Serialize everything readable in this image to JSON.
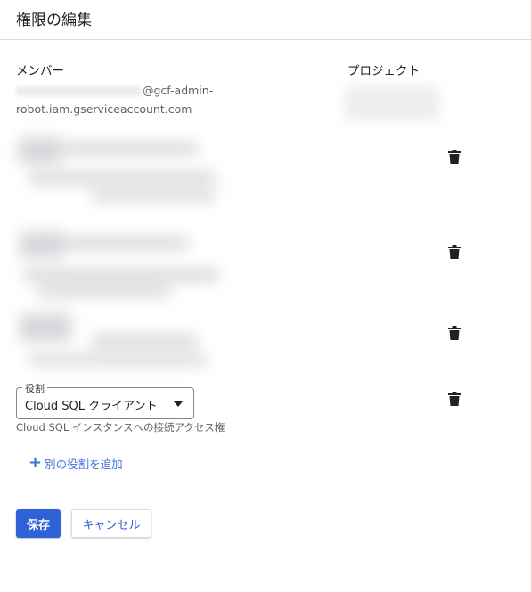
{
  "dialog": {
    "title": "権限の編集"
  },
  "columns": {
    "member": "メンバー",
    "project": "プロジェクト"
  },
  "member": {
    "line1_suffix": "@gcf-admin-",
    "line2": "robot.iam.gserviceaccount.com"
  },
  "role": {
    "legend": "役割",
    "selected": "Cloud SQL クライアント",
    "description": "Cloud SQL インスタンスへの接続アクセス権"
  },
  "actions": {
    "add_role": "別の役割を追加",
    "save": "保存",
    "cancel": "キャンセル"
  },
  "icons": {
    "trash": "trash-icon",
    "plus": "plus-icon",
    "dropdown": "dropdown-arrow-icon"
  },
  "colors": {
    "primary": "#2f62d6",
    "link": "#3c6fd8",
    "border": "#dadce0",
    "text": "#202124",
    "secondary_text": "#5f6368"
  }
}
